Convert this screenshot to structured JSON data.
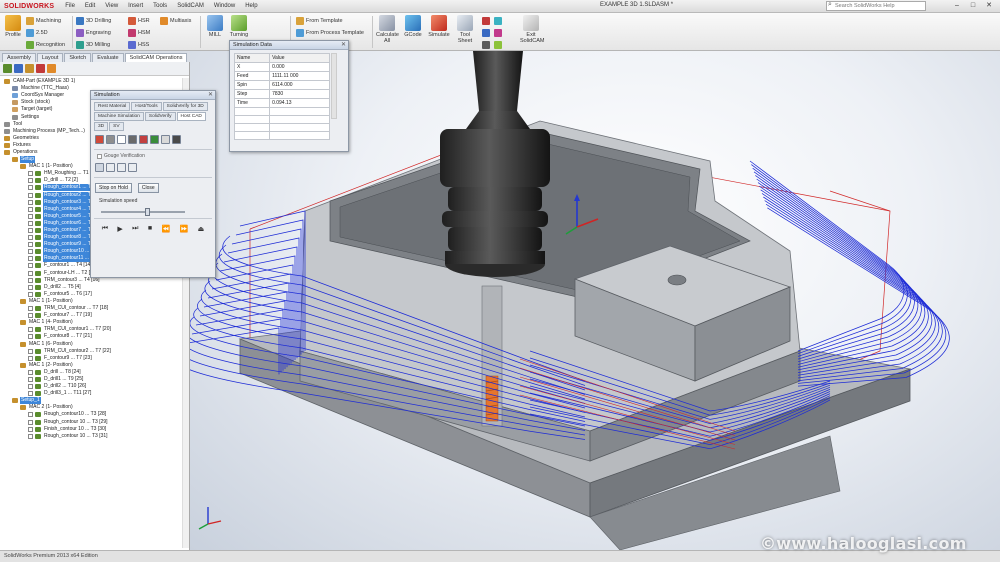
{
  "menubar": {
    "logo": "SOLIDWORKS",
    "items": [
      "File",
      "Edit",
      "View",
      "Insert",
      "Tools",
      "SolidCAM",
      "Window",
      "Help"
    ],
    "document_title": "EXAMPLE 3D 1.SLDASM *",
    "help_search_placeholder": "Search SolidWorks Help"
  },
  "ribbon": {
    "big_buttons": [
      "Profile",
      "MILL",
      "Turning",
      "Calculate All",
      "GCode",
      "Simulate",
      "Tool Sheet",
      "Exit SolidCAM"
    ],
    "small_groups": [
      [
        "Machining",
        "2.5D",
        "Recognition"
      ],
      [
        "3D Drilling",
        "Engraving",
        "3D Milling"
      ],
      [
        "HSR",
        "HSM",
        "HSS"
      ],
      [
        "Multiaxis"
      ],
      [
        "From Template",
        "From Process Template"
      ]
    ]
  },
  "command_tabs": [
    "Assembly",
    "Layout",
    "Sketch",
    "Evaluate",
    "SolidCAM Operations"
  ],
  "tree": {
    "items": [
      {
        "label": "CAM-Part (EXAMPLE 3D 1)",
        "level": 0,
        "color": "#c5902d",
        "sel": false,
        "chk": false
      },
      {
        "label": "Machine (TTC_Haas)",
        "level": 1,
        "color": "#7a8aa8",
        "sel": false,
        "chk": false
      },
      {
        "label": "CoordSys Manager",
        "level": 1,
        "color": "#6ea0d8",
        "sel": false,
        "chk": false
      },
      {
        "label": "Stock (stock)",
        "level": 1,
        "color": "#c59a62",
        "sel": false,
        "chk": false
      },
      {
        "label": "Target (target)",
        "level": 1,
        "color": "#d0a060",
        "sel": false,
        "chk": false
      },
      {
        "label": "Settings",
        "level": 1,
        "color": "#8e8e8e",
        "sel": false,
        "chk": false
      },
      {
        "label": "Tool",
        "level": 0,
        "color": "#8e8e8e",
        "sel": false,
        "chk": false
      },
      {
        "label": "Machining Process (MP_Tech...)",
        "level": 0,
        "color": "#8e8e8e",
        "sel": false,
        "chk": false
      },
      {
        "label": "Geometries",
        "level": 0,
        "color": "#c5902d",
        "sel": false,
        "chk": false
      },
      {
        "label": "Fixtures",
        "level": 0,
        "color": "#c5902d",
        "sel": false,
        "chk": false
      },
      {
        "label": "Operations",
        "level": 0,
        "color": "#c5902d",
        "sel": false,
        "chk": false
      },
      {
        "label": "Setup",
        "level": 1,
        "color": "#c5902d",
        "sel": true,
        "chk": false
      },
      {
        "label": "MAC 1 (1- Position)",
        "level": 2,
        "color": "#c5902d",
        "sel": false,
        "chk": false
      },
      {
        "label": "HM_Roughing ... T1 [1]",
        "level": 3,
        "color": "#5a8c2d",
        "sel": false,
        "chk": true
      },
      {
        "label": "D_drill ... T2 [2]",
        "level": 3,
        "color": "#5a8c2d",
        "sel": false,
        "chk": true
      },
      {
        "label": "Rough_contour1 ... T3 [3]",
        "level": 3,
        "color": "#5a8c2d",
        "sel": true,
        "chk": true
      },
      {
        "label": "Rough_contour2 ... T3 [4]",
        "level": 3,
        "color": "#5a8c2d",
        "sel": true,
        "chk": true
      },
      {
        "label": "Rough_contour3 ... T3 [5]",
        "level": 3,
        "color": "#5a8c2d",
        "sel": true,
        "chk": true
      },
      {
        "label": "Rough_contour4 ... T3 [6]",
        "level": 3,
        "color": "#5a8c2d",
        "sel": true,
        "chk": true
      },
      {
        "label": "Rough_contour5 ... T3 [7]",
        "level": 3,
        "color": "#5a8c2d",
        "sel": true,
        "chk": true
      },
      {
        "label": "Rough_contour6 ... T3 [8]",
        "level": 3,
        "color": "#5a8c2d",
        "sel": true,
        "chk": true
      },
      {
        "label": "Rough_contour7 ... T3 [9]",
        "level": 3,
        "color": "#5a8c2d",
        "sel": true,
        "chk": true
      },
      {
        "label": "Rough_contour8 ... T3 [10]",
        "level": 3,
        "color": "#5a8c2d",
        "sel": true,
        "chk": true
      },
      {
        "label": "Rough_contour9 ... T3 [11]",
        "level": 3,
        "color": "#5a8c2d",
        "sel": true,
        "chk": true
      },
      {
        "label": "Rough_contour10 ... T3 [12]",
        "level": 3,
        "color": "#5a8c2d",
        "sel": true,
        "chk": true
      },
      {
        "label": "Rough_contour11 ... T3 [13]",
        "level": 3,
        "color": "#5a8c2d",
        "sel": true,
        "chk": true
      },
      {
        "label": "F_contour1 ... T4 [14]",
        "level": 3,
        "color": "#5a8c2d",
        "sel": false,
        "chk": true
      },
      {
        "label": "F_contour-LH ... T2 [15]",
        "level": 3,
        "color": "#5a8c2d",
        "sel": false,
        "chk": true
      },
      {
        "label": "TRM_contour3 ... T4 [16]",
        "level": 3,
        "color": "#5a8c2d",
        "sel": false,
        "chk": true
      },
      {
        "label": "D_drill2 ... T5 [4]",
        "level": 3,
        "color": "#5a8c2d",
        "sel": false,
        "chk": true
      },
      {
        "label": "F_contour5 ... T6 [17]",
        "level": 3,
        "color": "#5a8c2d",
        "sel": false,
        "chk": true
      },
      {
        "label": "MAC 1 (1- Position)",
        "level": 2,
        "color": "#c5902d",
        "sel": false,
        "chk": false
      },
      {
        "label": "TRM_CUI_contour ... T7 [18]",
        "level": 3,
        "color": "#5a8c2d",
        "sel": false,
        "chk": true
      },
      {
        "label": "F_contour7 ... T7 [19]",
        "level": 3,
        "color": "#5a8c2d",
        "sel": false,
        "chk": true
      },
      {
        "label": "MAC 1 (4- Position)",
        "level": 2,
        "color": "#c5902d",
        "sel": false,
        "chk": false
      },
      {
        "label": "TRM_CUI_contour1 ... T7 [20]",
        "level": 3,
        "color": "#5a8c2d",
        "sel": false,
        "chk": true
      },
      {
        "label": "F_contour8 ... T7 [21]",
        "level": 3,
        "color": "#5a8c2d",
        "sel": false,
        "chk": true
      },
      {
        "label": "MAC 1 (6- Position)",
        "level": 2,
        "color": "#c5902d",
        "sel": false,
        "chk": false
      },
      {
        "label": "TRM_CUI_contour2 ... T7 [22]",
        "level": 3,
        "color": "#5a8c2d",
        "sel": false,
        "chk": true
      },
      {
        "label": "F_contour9 ... T7 [23]",
        "level": 3,
        "color": "#5a8c2d",
        "sel": false,
        "chk": true
      },
      {
        "label": "MAC 1 (2- Position)",
        "level": 2,
        "color": "#c5902d",
        "sel": false,
        "chk": false
      },
      {
        "label": "D_drill ... T8 [24]",
        "level": 3,
        "color": "#5a8c2d",
        "sel": false,
        "chk": true
      },
      {
        "label": "D_drill1 ... T9 [25]",
        "level": 3,
        "color": "#5a8c2d",
        "sel": false,
        "chk": true
      },
      {
        "label": "D_drill2 ... T10 [26]",
        "level": 3,
        "color": "#5a8c2d",
        "sel": false,
        "chk": true
      },
      {
        "label": "D_drill3_1 ... T11 [27]",
        "level": 3,
        "color": "#5a8c2d",
        "sel": false,
        "chk": true
      },
      {
        "label": "Setup_1",
        "level": 1,
        "color": "#c5902d",
        "sel": true,
        "chk": false
      },
      {
        "label": "MAC 2 (1- Position)",
        "level": 2,
        "color": "#c5902d",
        "sel": false,
        "chk": false
      },
      {
        "label": "Rough_contour10 ... T3 [28]",
        "level": 3,
        "color": "#5a8c2d",
        "sel": false,
        "chk": true
      },
      {
        "label": "Rough_contour 10 ... T3 [29]",
        "level": 3,
        "color": "#5a8c2d",
        "sel": false,
        "chk": true
      },
      {
        "label": "Finish_contour 10 ... T3 [30]",
        "level": 3,
        "color": "#5a8c2d",
        "sel": false,
        "chk": true
      },
      {
        "label": "Rough_contour 10 ... T3 [31]",
        "level": 3,
        "color": "#5a8c2d",
        "sel": false,
        "chk": true
      }
    ]
  },
  "simulation_data": {
    "title": "Simulation Data",
    "headers": [
      "Name",
      "Value"
    ],
    "rows": [
      [
        "X",
        "0.000"
      ],
      [
        "Feed",
        "1111.11 000"
      ],
      [
        "Spin",
        "6114.000"
      ],
      [
        "Step",
        "7830"
      ],
      [
        "Time",
        "0.094.13"
      ]
    ]
  },
  "simulation": {
    "title": "Simulation",
    "tabs": [
      "Rest Material",
      "Host/Tools",
      "SolidVerify for 3D",
      "Machine Simulation",
      "SolidVerify",
      "Host CAD",
      "3D",
      "SV"
    ],
    "active_tab": "Host CAD",
    "check_label": "Gouge Verification",
    "stop_button": "Stop on Hold",
    "close_button": "Close",
    "speed_label": "Simulation speed",
    "speed_level": 0.52,
    "play_controls": [
      "⏮",
      "▶",
      "⏭",
      "■",
      "⏪",
      "⏩",
      "⏏"
    ]
  },
  "statusbar": {
    "text": "SolidWorks Premium 2013 x64 Edition"
  },
  "watermark": "©www.halooglasi.com",
  "colors": {
    "toolpath_blue": "#1e2cd6",
    "toolpath_red": "#d12828",
    "part_gray": "#a9acb0",
    "selection_blue": "#3d86d9"
  }
}
